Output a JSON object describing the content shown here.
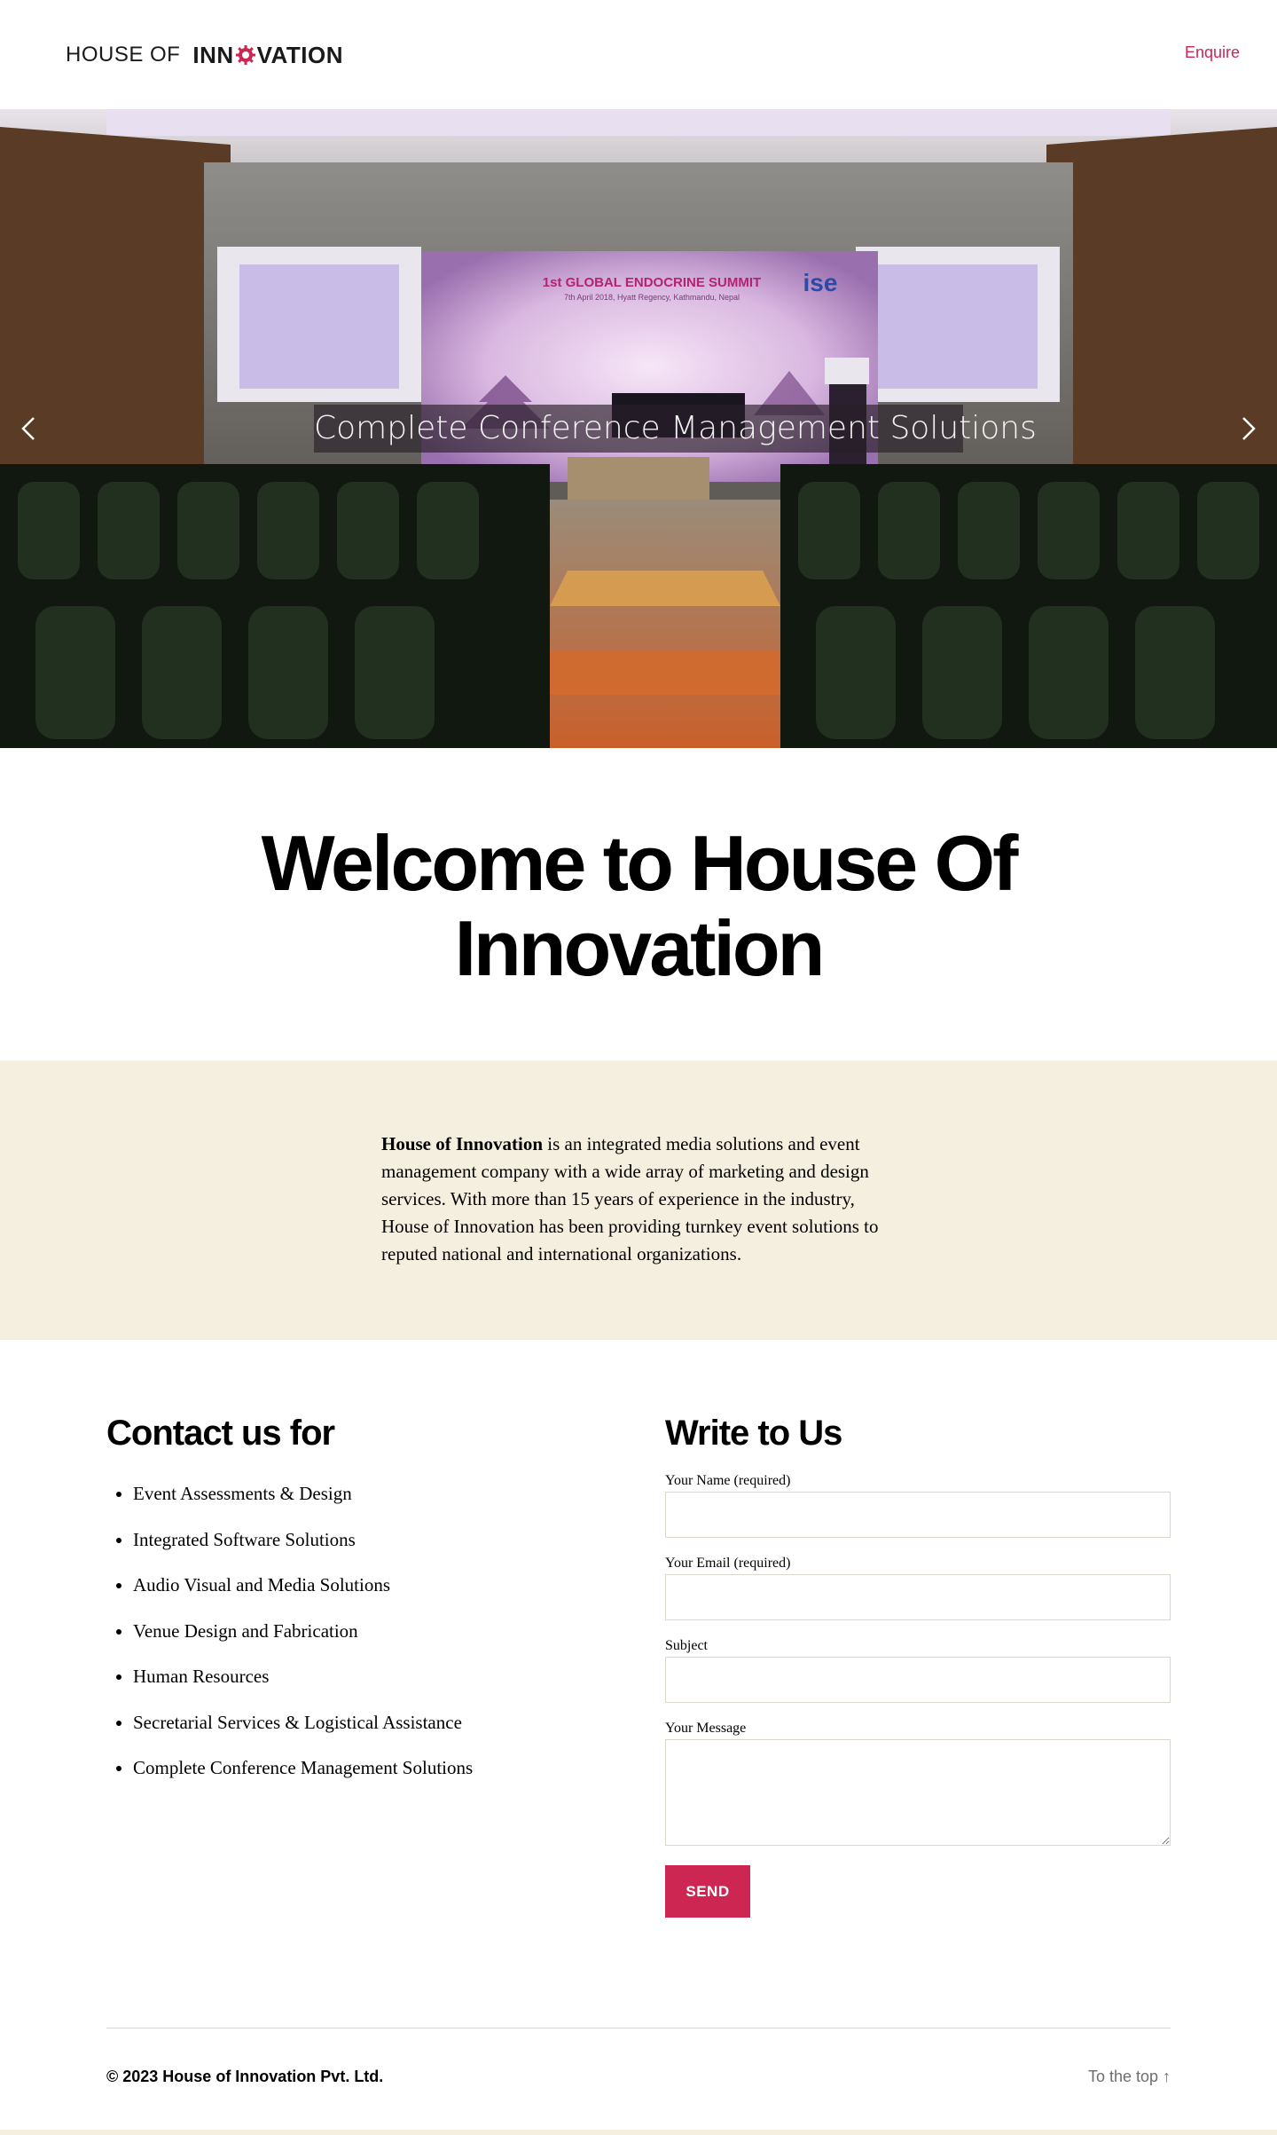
{
  "header": {
    "logo_light": "HOUSE OF",
    "logo_bold_pre": "INN",
    "logo_bold_post": "VATION",
    "enquire_label": "Enquire"
  },
  "hero": {
    "caption": "Complete Conference Management Solutions",
    "prev_icon": "chevron-left-icon",
    "next_icon": "chevron-right-icon",
    "banner_title": "1st GLOBAL ENDOCRINE SUMMIT",
    "banner_sub": "7th April 2018, Hyatt Regency, Kathmandu, Nepal",
    "banner_logo": "ise"
  },
  "welcome": {
    "title": "Welcome to House Of Innovation"
  },
  "about": {
    "company": "House of Innovation",
    "text": " is an integrated media solutions and event management company with a wide array of marketing and design services. With more than 15 years of experience in the industry, House of Innovation has been providing turnkey event solutions to reputed national and international organizations."
  },
  "contact": {
    "title": "Contact us for",
    "services": [
      "Event Assessments & Design",
      "Integrated Software Solutions",
      "Audio Visual and Media Solutions",
      "Venue Design and Fabrication",
      "Human Resources",
      "Secretarial Services & Logistical Assistance",
      "Complete Conference Management Solutions"
    ]
  },
  "form": {
    "title": "Write to Us",
    "name_label": "Your Name (required)",
    "email_label": "Your Email (required)",
    "subject_label": "Subject",
    "message_label": "Your Message",
    "send_label": "SEND"
  },
  "footer": {
    "copyright": "© 2023 House of Innovation Pvt. Ltd.",
    "to_top": "To the top ↑"
  },
  "colors": {
    "accent": "#cd2653",
    "beige": "#f5efdf"
  }
}
